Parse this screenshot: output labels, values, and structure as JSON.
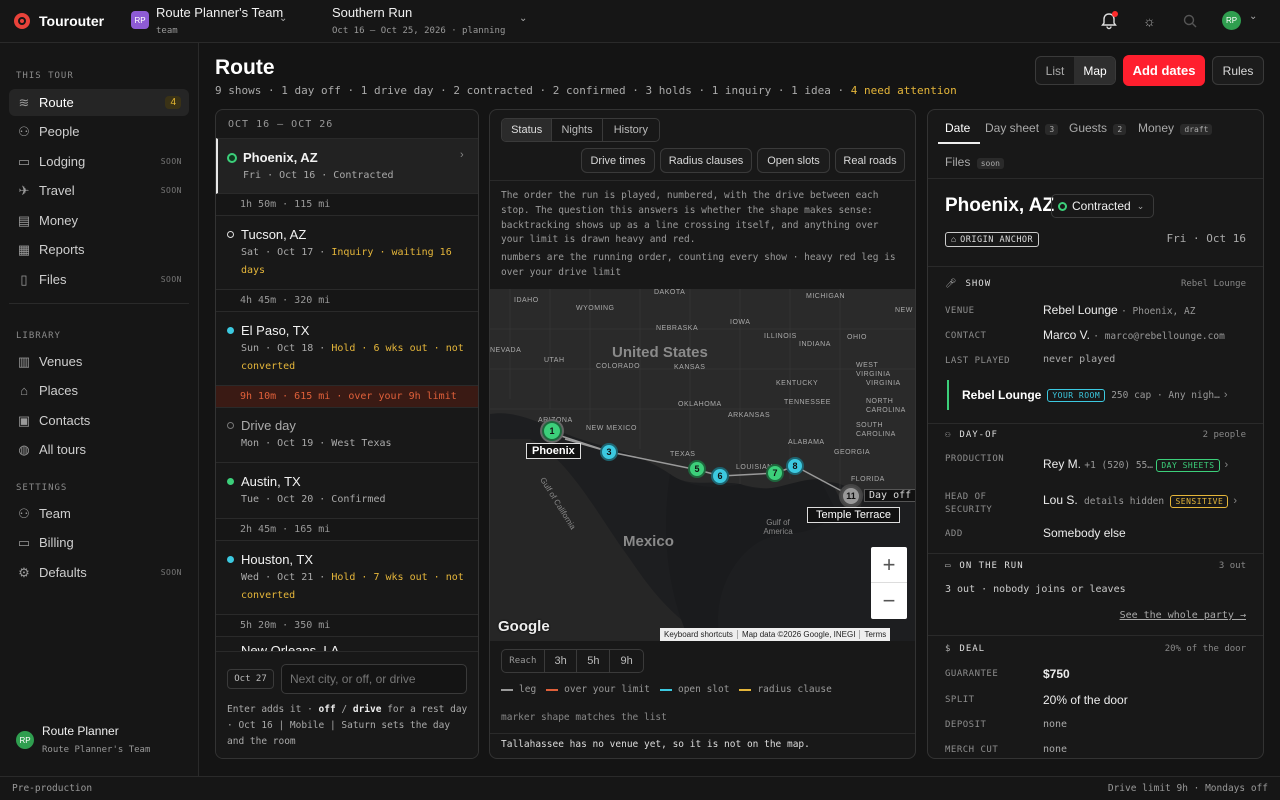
{
  "app": {
    "name": "Tourouter"
  },
  "team": {
    "initials": "RP",
    "name": "Route Planner's Team",
    "role": "team"
  },
  "tour": {
    "name": "Southern Run",
    "meta": "Oct 16 – Oct 25, 2026 · planning"
  },
  "user": {
    "initials": "RP"
  },
  "sidebar": {
    "this_tour": "THIS TOUR",
    "tour_items": [
      {
        "label": "Route",
        "count": "4"
      },
      {
        "label": "People"
      },
      {
        "label": "Lodging",
        "badge": "SOON"
      },
      {
        "label": "Travel",
        "badge": "SOON"
      },
      {
        "label": "Money"
      },
      {
        "label": "Reports"
      },
      {
        "label": "Files",
        "badge": "SOON"
      }
    ],
    "library": "LIBRARY",
    "library_items": [
      {
        "label": "Venues"
      },
      {
        "label": "Places"
      },
      {
        "label": "Contacts"
      },
      {
        "label": "All tours"
      }
    ],
    "settings": "SETTINGS",
    "settings_items": [
      {
        "label": "Team"
      },
      {
        "label": "Billing"
      },
      {
        "label": "Defaults",
        "badge": "SOON"
      }
    ],
    "profile": {
      "initials": "RP",
      "name": "Route Planner",
      "team": "Route Planner's Team"
    }
  },
  "page": {
    "title": "Route",
    "summary": "9 shows · 1 day off · 1 drive day · 2 contracted · 2 confirmed · 3 holds · 1 inquiry · 1 idea · ",
    "attention": "4 need attention"
  },
  "toolbar": {
    "list": "List",
    "map": "Map",
    "add_dates": "Add dates",
    "rules": "Rules"
  },
  "route_list": {
    "range": "OCT 16 — OCT 26",
    "stops": [
      {
        "city": "Phoenix, AZ",
        "line1": "Fri · Oct 16 · Contracted",
        "color": "#3ccf7a"
      },
      {
        "leg": "1h 50m · 115 mi"
      },
      {
        "city": "Tucson, AZ",
        "a": "Sat · Oct 17 · ",
        "b": "Inquiry · waiting 16 days"
      },
      {
        "leg": "4h 45m · 320 mi"
      },
      {
        "city": "El Paso, TX",
        "a": "Sun · Oct 18 · ",
        "b": "Hold · 6 wks out · not converted",
        "color": "#3cc9e0"
      },
      {
        "leg": "9h 10m · 615 mi · over your 9h limit"
      },
      {
        "city": "Drive day",
        "line1": "Mon · Oct 19 · West Texas"
      },
      {
        "city": "Austin, TX",
        "line1": "Tue · Oct 20 · Confirmed",
        "color": "#3ccf7a"
      },
      {
        "leg": "2h 45m · 165 mi"
      },
      {
        "city": "Houston, TX",
        "a": "Wed · Oct 21 · ",
        "b": "Hold · 7 wks out · not converted",
        "color": "#3cc9e0"
      },
      {
        "leg": "5h 20m · 350 mi"
      },
      {
        "city": "New Orleans, LA"
      }
    ],
    "date_chip": "Oct 27",
    "input_placeholder": "Next city, or off, or drive",
    "help1": "Enter adds it · ",
    "help_off": "off",
    "help_sep": " / ",
    "help_drive": "drive",
    "help2": " for a rest day · Oct 16 | Mobile | Saturn sets the day and the room"
  },
  "map_panel": {
    "tabs": [
      "Status",
      "Nights",
      "History"
    ],
    "filters": [
      "Drive times",
      "Radius clauses",
      "Open slots",
      "Real roads"
    ],
    "desc": "The order the run is played, numbered, with the drive between each stop. The question this answers is whether the shape makes sense: backtracking shows up as a line crossing itself, and anything over your limit is drawn heavy and red.",
    "desc2": "numbers are the running order, counting every show · heavy red leg is over your drive limit",
    "labels": {
      "us": "United States",
      "mexico": "Mexico",
      "gulf_ca": "Gulf of California",
      "gulf_am": "Gulf of America",
      "phoenix": "Phoenix",
      "temple": "Temple Terrace",
      "dayoff": "Day off"
    },
    "states": [
      "IDAHO",
      "WYOMING",
      "DAKOTA",
      "MICHIGAN",
      "NEBRASKA",
      "IOWA",
      "NEW",
      "NEVADA",
      "UTAH",
      "COLORADO",
      "KANSAS",
      "ILLINOIS",
      "INDIANA",
      "OHIO",
      "WEST VIRGINIA",
      "KENTUCKY",
      "VIRGINIA",
      "ARIZONA",
      "NEW MEXICO",
      "OKLAHOMA",
      "TENNESSEE",
      "NORTH CAROLINA",
      "ARKANSAS",
      "SOUTH CAROLINA",
      "ALABAMA",
      "GEORGIA",
      "TEXAS",
      "LOUISIANA",
      "FLORIDA"
    ],
    "markers": [
      "1",
      "3",
      "5",
      "6",
      "7",
      "8",
      "11"
    ],
    "zoom_in": "+",
    "zoom_out": "−",
    "attribution": [
      "Keyboard shortcuts",
      "Map data ©2026 Google, INEGI",
      "Terms"
    ],
    "google": "Google",
    "reach": "Reach",
    "reach_opts": [
      "3h",
      "5h",
      "9h"
    ],
    "legend": [
      {
        "label": "leg",
        "color": "#9a9a9a"
      },
      {
        "label": "over your limit",
        "color": "#e0603a"
      },
      {
        "label": "open slot",
        "color": "#3cc9e0"
      },
      {
        "label": "radius clause",
        "color": "#e5b63a"
      }
    ],
    "legend_note": "marker shape matches the list",
    "footer": "Tallahassee has no venue yet, so it is not on the map."
  },
  "detail": {
    "tabs": [
      {
        "label": "Date"
      },
      {
        "label": "Day sheet",
        "badge": "3"
      },
      {
        "label": "Guests",
        "badge": "2"
      },
      {
        "label": "Money",
        "badge": "draft"
      },
      {
        "label": "Files",
        "badge": "soon"
      }
    ],
    "city": "Phoenix, AZ",
    "status": "Contracted",
    "anchor": "ORIGIN ANCHOR",
    "date": "Fri · Oct 16",
    "show": {
      "heading": "SHOW",
      "right": "Rebel Lounge",
      "venue_l": "VENUE",
      "venue": "Rebel Lounge",
      "venue_city": "· Phoenix, AZ",
      "contact_l": "CONTACT",
      "contact": "Marco V.",
      "contact_email": "· marco@rebellounge.com",
      "last_l": "LAST PLAYED",
      "last": "never played",
      "room": "Rebel Lounge",
      "room_tag": "YOUR ROOM",
      "room_info": "250 cap · Any nigh…"
    },
    "dayof": {
      "heading": "DAY-OF",
      "right": "2 people",
      "prod_l": "PRODUCTION",
      "prod": "Rey M.",
      "prod_info": "+1 (520) 55…",
      "prod_tag": "DAY SHEETS",
      "sec_l1": "HEAD OF",
      "sec_l2": "SECURITY",
      "sec": "Lou S.",
      "sec_info": "details hidden",
      "sec_tag": "SENSITIVE",
      "add_l": "ADD",
      "add": "Somebody else"
    },
    "run": {
      "heading": "ON THE RUN",
      "right": "3 out",
      "text": "3 out · nobody joins or leaves",
      "link": "See the whole party →"
    },
    "deal": {
      "heading": "DEAL",
      "right": "20% of the door",
      "g_l": "GUARANTEE",
      "g": "$750",
      "s_l": "SPLIT",
      "s": "20% of the door",
      "d_l": "DEPOSIT",
      "d": "none",
      "m_l": "MERCH CUT",
      "m": "none"
    }
  },
  "status_bar": {
    "left": "Pre-production",
    "right": "Drive limit 9h · Mondays off"
  },
  "colors": {
    "accent": "#ff1f2e",
    "attention": "#e5b63a",
    "confirmed": "#3ccf7a",
    "hold": "#3cc9e0",
    "danger": "#e0603a"
  }
}
